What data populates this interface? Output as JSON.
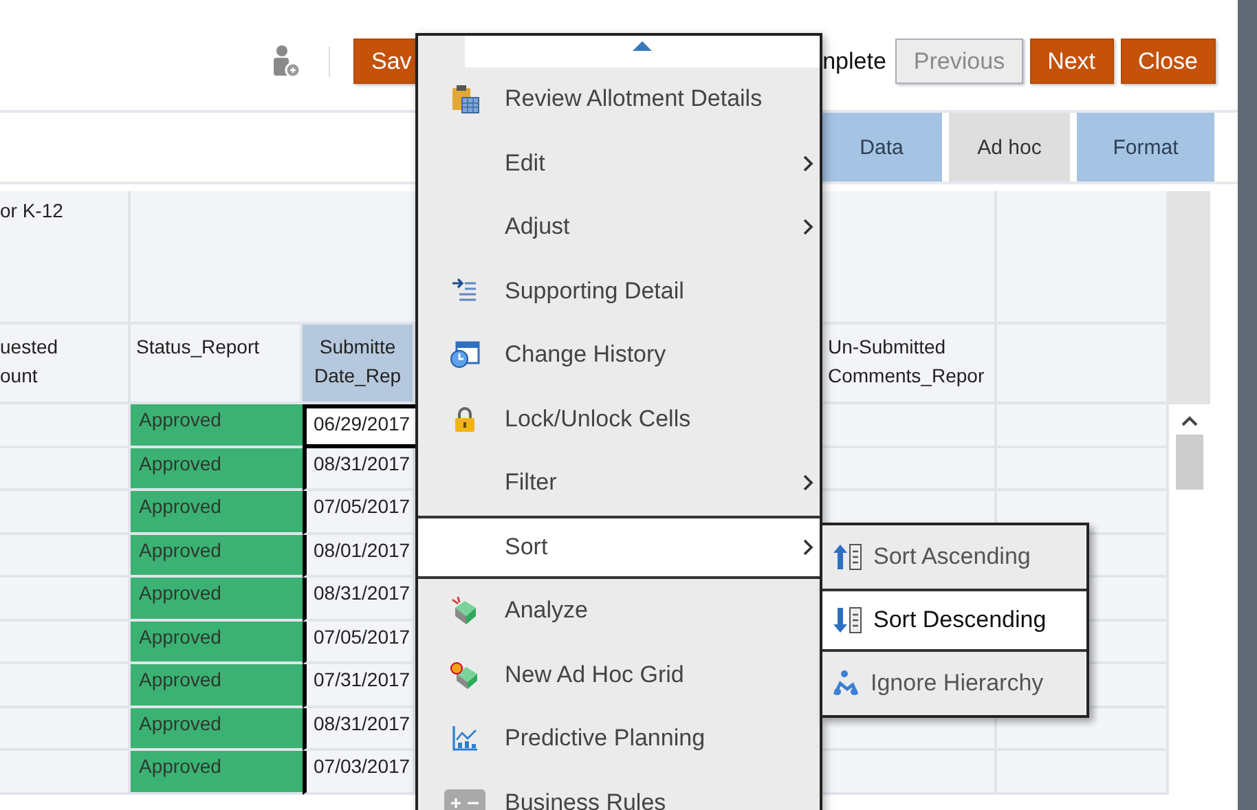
{
  "toolbar": {
    "save_button": "Sav",
    "complete_label": "nplete",
    "buttons": [
      {
        "label": "Previous",
        "disabled": true
      },
      {
        "label": "Next",
        "disabled": false
      },
      {
        "label": "Close",
        "disabled": false
      }
    ]
  },
  "tabs": [
    {
      "label": "Data",
      "selected": false
    },
    {
      "label": "Ad hoc",
      "selected": true
    },
    {
      "label": "Format",
      "selected": false
    }
  ],
  "grid": {
    "group_header": "or K-12",
    "columns": [
      "uested\nount",
      "Status_Report",
      "Submitte\nDate_Rep",
      "Un-Submitted\nComments_Repor"
    ],
    "rows": [
      {
        "status": "Approved",
        "submitted_date": "06/29/2017",
        "active": true
      },
      {
        "status": "Approved",
        "submitted_date": "08/31/2017",
        "active": false
      },
      {
        "status": "Approved",
        "submitted_date": "07/05/2017",
        "active": false
      },
      {
        "status": "Approved",
        "submitted_date": "08/01/2017",
        "active": false
      },
      {
        "status": "Approved",
        "submitted_date": "08/31/2017",
        "active": false
      },
      {
        "status": "Approved",
        "submitted_date": "07/05/2017",
        "active": false
      },
      {
        "status": "Approved",
        "submitted_date": "07/31/2017",
        "active": false
      },
      {
        "status": "Approved",
        "submitted_date": "08/31/2017",
        "active": false
      },
      {
        "status": "Approved",
        "submitted_date": "07/03/2017",
        "active": false
      }
    ]
  },
  "context_menu": {
    "items": [
      {
        "label": "Review Allotment Details",
        "submenu": false,
        "selected": false
      },
      {
        "label": "Edit",
        "submenu": true,
        "selected": false
      },
      {
        "label": "Adjust",
        "submenu": true,
        "selected": false
      },
      {
        "label": "Supporting Detail",
        "submenu": false,
        "selected": false
      },
      {
        "label": "Change History",
        "submenu": false,
        "selected": false
      },
      {
        "label": "Lock/Unlock Cells",
        "submenu": false,
        "selected": false
      },
      {
        "label": "Filter",
        "submenu": true,
        "selected": false
      },
      {
        "label": "Sort",
        "submenu": true,
        "selected": true
      },
      {
        "label": "Analyze",
        "submenu": false,
        "selected": false
      },
      {
        "label": "New Ad Hoc Grid",
        "submenu": false,
        "selected": false
      },
      {
        "label": "Predictive Planning",
        "submenu": false,
        "selected": false
      },
      {
        "label": "Business Rules",
        "submenu": false,
        "selected": false
      }
    ]
  },
  "sort_submenu": {
    "items": [
      {
        "label": "Sort Ascending",
        "selected": false
      },
      {
        "label": "Sort Descending",
        "selected": true
      },
      {
        "label": "Ignore Hierarchy",
        "selected": false
      }
    ]
  }
}
